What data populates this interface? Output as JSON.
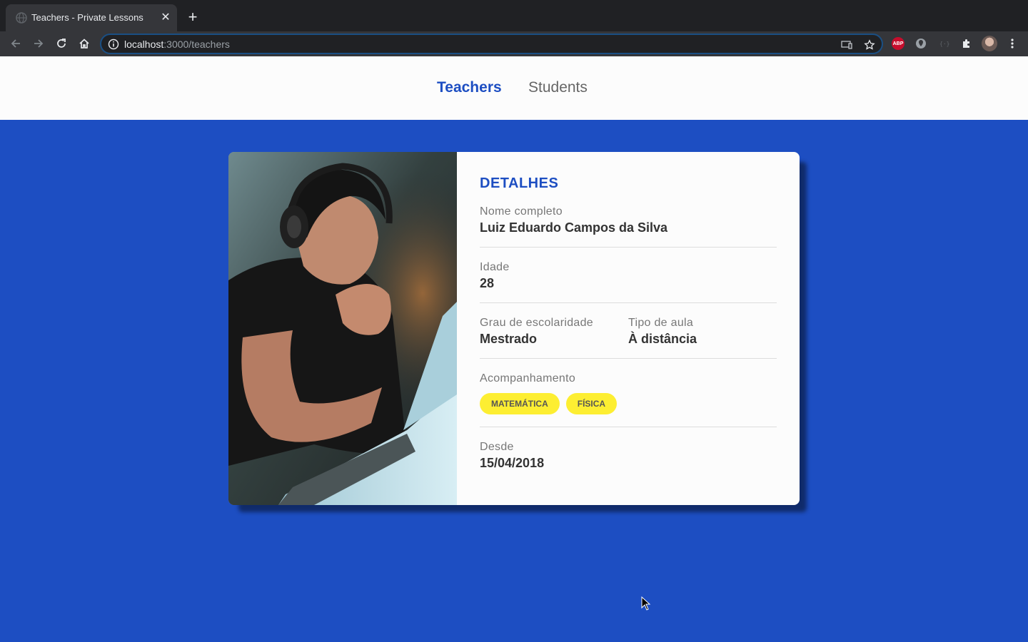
{
  "browser": {
    "tab_title": "Teachers - Private Lessons",
    "url_host": "localhost",
    "url_path": ":3000/teachers",
    "icons": {
      "favicon": "globe-icon",
      "close": "close-icon",
      "new_tab": "plus-icon",
      "back": "back-arrow-icon",
      "forward": "forward-arrow-icon",
      "reload": "reload-icon",
      "home": "home-icon",
      "site_info": "info-icon",
      "cast": "cast-icon",
      "bookmark": "star-icon",
      "extensions": "puzzle-icon",
      "menu": "kebab-menu-icon"
    },
    "extensions": {
      "adblock_label": "ABP"
    }
  },
  "header": {
    "nav": [
      {
        "label": "Teachers",
        "active": true
      },
      {
        "label": "Students",
        "active": false
      }
    ]
  },
  "card": {
    "title": "DETALHES",
    "fields": {
      "name": {
        "label": "Nome completo",
        "value": "Luiz Eduardo Campos da Silva"
      },
      "age": {
        "label": "Idade",
        "value": "28"
      },
      "education": {
        "label": "Grau de escolaridade",
        "value": "Mestrado"
      },
      "class_type": {
        "label": "Tipo de aula",
        "value": "À distância"
      },
      "subjects": {
        "label": "Acompanhamento",
        "items": [
          "MATEMÁTICA",
          "FÍSICA"
        ]
      },
      "since": {
        "label": "Desde",
        "value": "15/04/2018"
      }
    }
  },
  "colors": {
    "brand_blue": "#1d4ec2",
    "pill_yellow": "#fdee32",
    "card_bg": "#fcfcfc"
  }
}
